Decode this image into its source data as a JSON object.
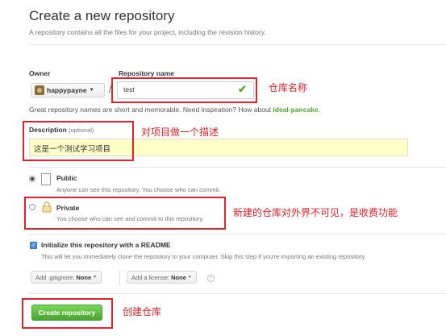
{
  "header": {
    "title": "Create a new repository",
    "subtitle": "A repository contains all the files for your project, including the revision history."
  },
  "owner": {
    "label": "Owner",
    "value": "happypayne"
  },
  "repo": {
    "label": "Repository name",
    "value": "test"
  },
  "hint": {
    "prefix": "Great repository names are short and memorable. Need inspiration? How about ",
    "suggestion": "ideal-pancake",
    "suffix": "."
  },
  "description": {
    "label": "Description",
    "optional": "(optional)",
    "value": "这是一个测试学习项目"
  },
  "visibility": {
    "public": {
      "title": "Public",
      "desc": "Anyone can see this repository. You choose who can commit.",
      "selected": true
    },
    "private": {
      "title": "Private",
      "desc": "You choose who can see and commit to this repository.",
      "selected": false
    }
  },
  "readme": {
    "checked": true,
    "title": "Initialize this repository with a README",
    "desc": "This will let you immediately clone the repository to your computer. Skip this step if you're importing an existing repository."
  },
  "gitignore": {
    "label": "Add .gitignore:",
    "value": "None"
  },
  "license": {
    "label": "Add a license:",
    "value": "None"
  },
  "create_button": "Create repository",
  "annotations": {
    "repo_name": "仓库名称",
    "description": "对项目做一个描述",
    "private": "新建的仓库对外界不可见，是收费功能",
    "create": "创建仓库"
  },
  "colors": {
    "annotation_red": "#e0222a",
    "create_green": "#55a532",
    "description_bg": "#ffffc8"
  }
}
